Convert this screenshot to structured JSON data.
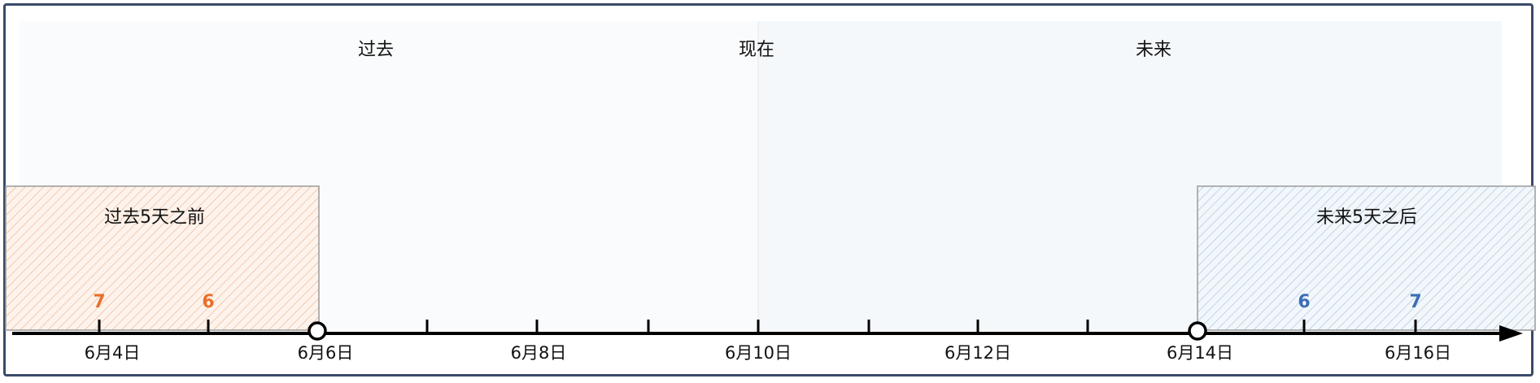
{
  "regions": {
    "past": "过去",
    "present": "现在",
    "future": "未来"
  },
  "boxes": {
    "past": {
      "label": "过去5天之前",
      "markers": [
        "7",
        "6"
      ]
    },
    "future": {
      "label": "未来5天之后",
      "markers": [
        "6",
        "7"
      ]
    }
  },
  "axis": {
    "labels": [
      "6月4日",
      "6月6日",
      "6月8日",
      "6月10日",
      "6月12日",
      "6月14日",
      "6月16日"
    ]
  },
  "colors": {
    "past_marker": "#e8702a",
    "future_marker": "#3d6eb5",
    "past_hatch": "#f4c9ae",
    "future_hatch": "#c3d5e6",
    "past_bg": "#fafbfc",
    "future_bg": "#f5f8fb",
    "axis": "#000000",
    "frame": "#3b4a6b"
  }
}
